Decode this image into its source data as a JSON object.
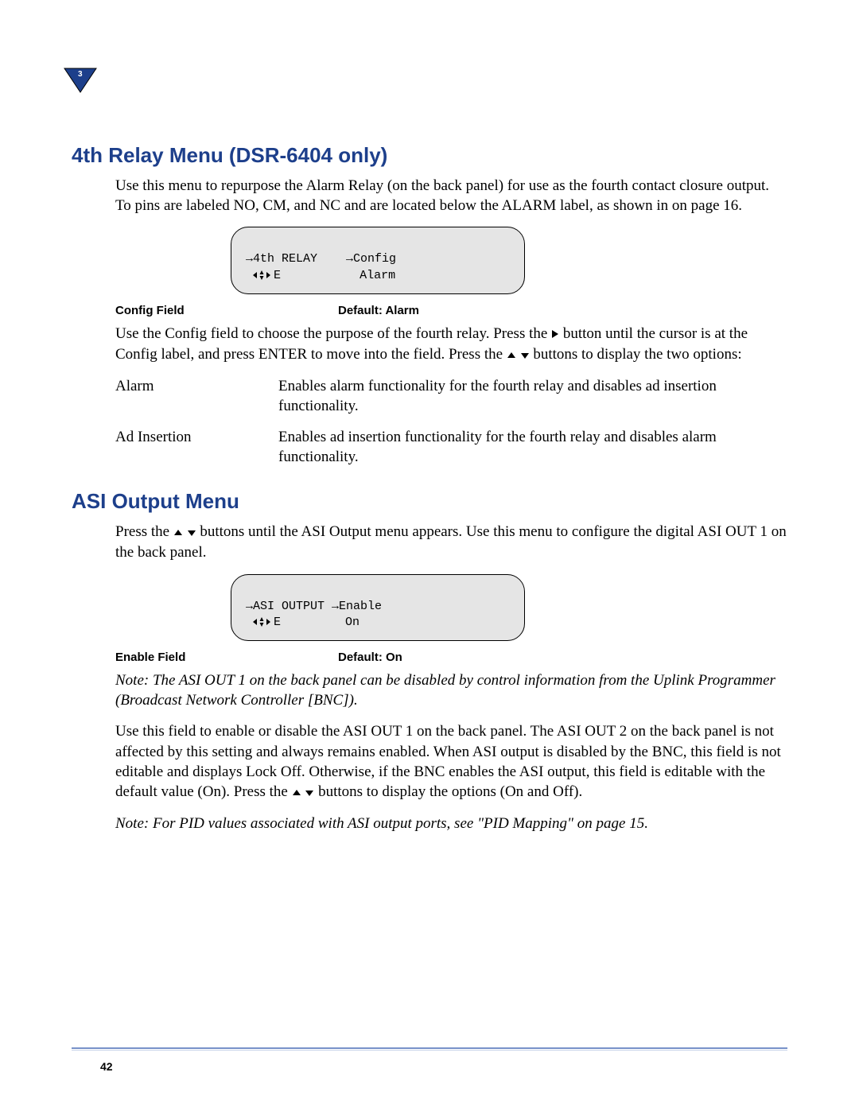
{
  "chapter_badge": "3",
  "page_number": "42",
  "section1": {
    "heading": "4th Relay Menu (DSR-6404 only)",
    "intro": "Use this menu to repurpose the Alarm Relay (on the back panel) for use as the fourth contact closure output. To pins are labeled NO, CM, and NC and are located below the ALARM label, as shown in on page 16.",
    "lcd": {
      "line1_left": "→4th RELAY",
      "line1_right": "→Config",
      "line2_left_e": "E",
      "line2_right": "Alarm"
    },
    "field_label": "Config Field",
    "field_default": "Default: Alarm",
    "config_para_a": "Use the Config field to choose the purpose of the fourth relay. Press the ",
    "config_para_b": " button until the cursor is at the Config label, and press ENTER to move into the field. Press the ",
    "config_para_c": " buttons to display the two options:",
    "options": [
      {
        "term": "Alarm",
        "def": "Enables alarm functionality for the fourth relay and disables ad insertion functionality."
      },
      {
        "term": "Ad Insertion",
        "def": "Enables ad insertion functionality for the fourth relay and disables alarm functionality."
      }
    ]
  },
  "section2": {
    "heading": "ASI Output Menu",
    "intro_a": "Press the ",
    "intro_b": " buttons until the ASI Output menu appears. Use this menu to configure the digital ASI OUT 1 on the back panel.",
    "lcd": {
      "line1_left": "→ASI OUTPUT",
      "line1_right": "→Enable",
      "line2_left_e": "E",
      "line2_right": "On"
    },
    "field_label": "Enable Field",
    "field_default": "Default: On",
    "note1": "Note:  The ASI OUT 1 on the back panel can be disabled by control information from the Uplink Programmer (Broadcast Network Controller [BNC]).",
    "body_a": "Use this field to enable or disable the ASI OUT 1 on the back panel. The ASI OUT 2 on the back panel is not affected by this setting and always remains enabled. When ASI output is disabled by the BNC, this field is not editable and displays Lock Off. Otherwise, if the BNC enables the ASI output, this field is editable with the default value (On). Press the ",
    "body_b": " buttons to display the options (On and Off).",
    "note2": "Note:  For PID values associated with ASI output ports, see \"PID Mapping\" on page 15."
  }
}
